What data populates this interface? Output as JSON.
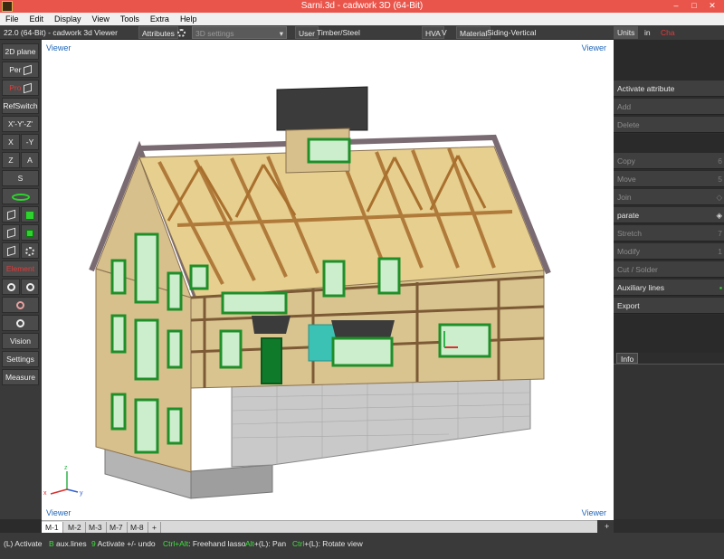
{
  "window": {
    "title": "Sarni.3d - cadwork 3D (64-Bit)",
    "controls": [
      "–",
      "□",
      "✕"
    ]
  },
  "menu": [
    "File",
    "Edit",
    "Display",
    "View",
    "Tools",
    "Extra",
    "Help"
  ],
  "toolbar": {
    "version": "22.0 (64-Bit) - cadwork 3d Viewer",
    "attributes_label": "Attributes",
    "settings_combo": "3D settings",
    "user_label": "User",
    "user_value": "Timber/Steel",
    "hva_label": "HVA",
    "v_label": "V",
    "material_label": "Material",
    "material_value": "Siding-Vertical"
  },
  "left_tools": [
    {
      "label": "2D plane"
    },
    {
      "label": "Per"
    },
    {
      "label": "Pro"
    },
    {
      "label": "RefSwitch"
    },
    {
      "label": "X'-Y'-Z'"
    },
    {
      "label": "X"
    },
    {
      "label": "-Y"
    },
    {
      "label": "Z"
    },
    {
      "label": "A"
    },
    {
      "label": "S"
    },
    {
      "label": "Element"
    },
    {
      "label": "Vision"
    },
    {
      "label": "Settings"
    },
    {
      "label": "Measure"
    }
  ],
  "viewport": {
    "label": "Viewer",
    "axes": {
      "x": "x",
      "y": "y",
      "z": "z"
    }
  },
  "tabs": [
    "M-1",
    "M-2",
    "M-3",
    "M-7",
    "M-8",
    "+"
  ],
  "tabs_right_plus": "+",
  "status": [
    {
      "key": "(L)",
      "text": " Activate"
    },
    {
      "key": "B",
      "text": " aux.lines"
    },
    {
      "key": "9",
      "text": " Activate +/- undo"
    },
    {
      "key": "Ctrl+Alt",
      "text": ": Freehand lasso"
    },
    {
      "key": "Alt",
      "text": "+(L): Pan"
    },
    {
      "key": "Ctrl",
      "text": "+(L): Rotate view"
    }
  ],
  "right_panel": {
    "tabs": {
      "units": "Units",
      "in": "in",
      "active": "Cha"
    },
    "buttons": [
      {
        "label": "Activate attribute",
        "shortcut": "",
        "dim": false
      },
      {
        "label": "Add",
        "shortcut": "",
        "dim": true
      },
      {
        "label": "Delete",
        "shortcut": "",
        "dim": true
      },
      {
        "label": "Copy",
        "shortcut": "6",
        "dim": true
      },
      {
        "label": "Move",
        "shortcut": "5",
        "dim": true
      },
      {
        "label": "Join",
        "shortcut": "",
        "dim": true
      },
      {
        "label": "parate",
        "shortcut": "",
        "dim": false
      },
      {
        "label": "Stretch",
        "shortcut": "7",
        "dim": true
      },
      {
        "label": "Modify",
        "shortcut": "1",
        "dim": true
      },
      {
        "label": "Cut / Solder",
        "shortcut": "",
        "dim": true
      },
      {
        "label": "Auxiliary lines",
        "shortcut": "",
        "dim": false
      },
      {
        "label": "Export",
        "shortcut": "",
        "dim": false
      }
    ],
    "info_tab": "Info"
  },
  "colors": {
    "titlebar": "#e9554b",
    "siding": "#d8c08c",
    "timber": "#c9964f",
    "window_frame": "#1f8f2a",
    "roof_edge": "#7a6a72",
    "foundation": "#c8c8c8"
  }
}
